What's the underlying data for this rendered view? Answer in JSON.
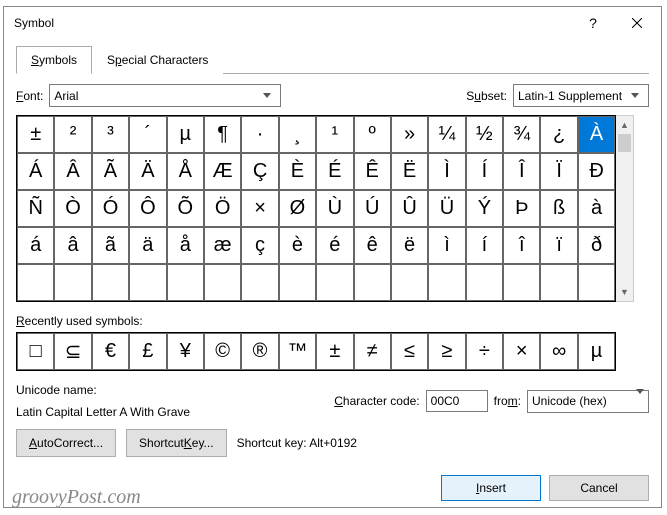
{
  "title": "Symbol",
  "tabs": {
    "symbols": "Symbols",
    "special": "Special Characters"
  },
  "font": {
    "label": "Font:",
    "value": "Arial"
  },
  "subset": {
    "label": "Subset:",
    "value": "Latin-1 Supplement"
  },
  "grid": [
    [
      "±",
      "²",
      "³",
      "´",
      "µ",
      "¶",
      "·",
      "¸",
      "¹",
      "º",
      "»",
      "¼",
      "½",
      "¾",
      "¿",
      "À"
    ],
    [
      "Á",
      "Â",
      "Ã",
      "Ä",
      "Å",
      "Æ",
      "Ç",
      "È",
      "É",
      "Ê",
      "Ë",
      "Ì",
      "Í",
      "Î",
      "Ï",
      "Ð"
    ],
    [
      "Ñ",
      "Ò",
      "Ó",
      "Ô",
      "Õ",
      "Ö",
      "×",
      "Ø",
      "Ù",
      "Ú",
      "Û",
      "Ü",
      "Ý",
      "Þ",
      "ß",
      "à"
    ],
    [
      "á",
      "â",
      "ã",
      "ä",
      "å",
      "æ",
      "ç",
      "è",
      "é",
      "ê",
      "ë",
      "ì",
      "í",
      "î",
      "ï",
      "ð"
    ],
    [
      "",
      "",
      "",
      "",
      "",
      "",
      "",
      "",
      "",
      "",
      "",
      "",
      "",
      "",
      "",
      ""
    ]
  ],
  "selected": {
    "row": 0,
    "col": 15
  },
  "recentLabel": "Recently used symbols:",
  "recent": [
    "□",
    "⊆",
    "€",
    "£",
    "¥",
    "©",
    "®",
    "™",
    "±",
    "≠",
    "≤",
    "≥",
    "÷",
    "×",
    "∞",
    "µ"
  ],
  "unicode": {
    "label": "Unicode name:",
    "value": "Latin Capital Letter A With Grave"
  },
  "charcode": {
    "label": "Character code:",
    "value": "00C0"
  },
  "from": {
    "label": "from:",
    "value": "Unicode (hex)"
  },
  "autocorrect": "AutoCorrect...",
  "shortcutKey": "Shortcut Key...",
  "shortcutLabel": "Shortcut key:",
  "shortcutValue": "Alt+0192",
  "insert": "Insert",
  "cancel": "Cancel",
  "watermark": "groovyPost.com"
}
